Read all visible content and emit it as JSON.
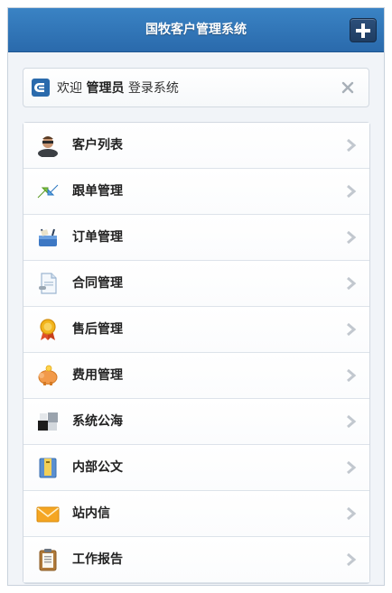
{
  "header": {
    "title": "国牧客户管理系统"
  },
  "welcome": {
    "prefix": "欢迎",
    "user": "管理员",
    "suffix": "登录系统"
  },
  "menu": [
    {
      "label": "客户列表",
      "icon": "customer-avatar-icon"
    },
    {
      "label": "跟单管理",
      "icon": "arrows-exchange-icon"
    },
    {
      "label": "订单管理",
      "icon": "cart-icon"
    },
    {
      "label": "合同管理",
      "icon": "document-icon"
    },
    {
      "label": "售后管理",
      "icon": "award-ribbon-icon"
    },
    {
      "label": "费用管理",
      "icon": "piggy-bank-icon"
    },
    {
      "label": "系统公海",
      "icon": "squares-icon"
    },
    {
      "label": "内部公文",
      "icon": "binder-icon"
    },
    {
      "label": "站内信",
      "icon": "envelope-icon"
    },
    {
      "label": "工作报告",
      "icon": "clipboard-icon"
    }
  ],
  "colors": {
    "header": "#2f73b6",
    "accent": "#1f3d62"
  }
}
